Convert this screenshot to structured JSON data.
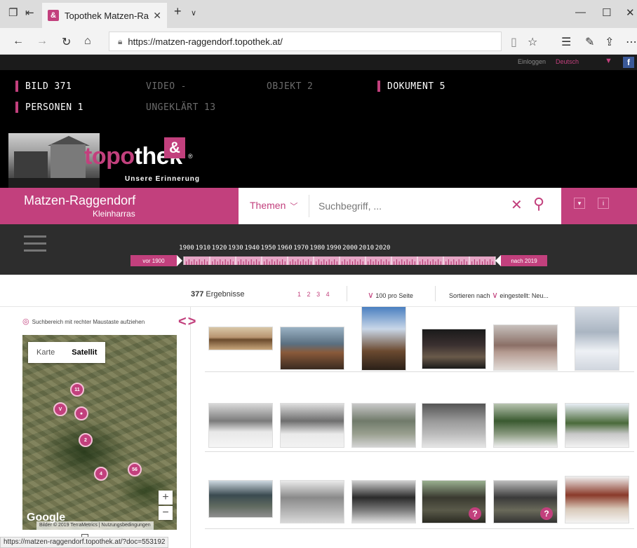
{
  "browser": {
    "tab_title": "Topothek Matzen-Ragg",
    "tab_favicon_letter": "&",
    "url": "https://matzen-raggendorf.topothek.at/"
  },
  "topstrip": {
    "login": "Einloggen",
    "language": "Deutsch",
    "fb": "f"
  },
  "counts": [
    {
      "label": "BILD",
      "value": "371",
      "active": true
    },
    {
      "label": "VIDEO",
      "value": "-",
      "active": false
    },
    {
      "label": "OBJEKT",
      "value": "2",
      "active": false
    },
    {
      "label": "DOKUMENT",
      "value": "5",
      "active": true
    },
    {
      "label": "PERSONEN",
      "value": "1",
      "active": true
    },
    {
      "label": "UNGEKLÄRT",
      "value": "13",
      "active": false
    }
  ],
  "brand": {
    "topo": "topo",
    "thek": "thek",
    "reg": "®",
    "slogan": "Unsere Erinnerung",
    "mark": "&"
  },
  "location": {
    "place": "Matzen-Raggendorf",
    "sub": "Kleinharras"
  },
  "search": {
    "themen_label": "Themen",
    "placeholder": "Suchbegriff, ...",
    "btn1": "▾",
    "btn2": "i"
  },
  "timeline": {
    "years": [
      "1900",
      "1910",
      "1920",
      "1930",
      "1940",
      "1950",
      "1960",
      "1970",
      "1980",
      "1990",
      "2000",
      "2010",
      "2020"
    ],
    "before_label": "vor 1900",
    "after_label": "nach 2019"
  },
  "results": {
    "count": "377",
    "count_label": "Ergebnisse",
    "pages": [
      "1",
      "2",
      "3",
      "4"
    ],
    "per_page": "100 pro Seite",
    "sort_label": "Sortieren nach",
    "sort_value": "eingestellt: Neu..."
  },
  "map": {
    "hint": "Suchbereich mit rechter Maustaste aufziehen",
    "type_map": "Karte",
    "type_satellite": "Satellit",
    "markers": [
      "11",
      "",
      "",
      "2",
      "4",
      "56"
    ],
    "google": "Google",
    "attribution": "Bilder © 2019 TerraMetrics | Nutzungsbedingungen",
    "zoom_in": "+",
    "zoom_out": "−"
  },
  "status_url": "https://matzen-raggendorf.topothek.at/?doc=553192",
  "accent_color": "#c2407d"
}
